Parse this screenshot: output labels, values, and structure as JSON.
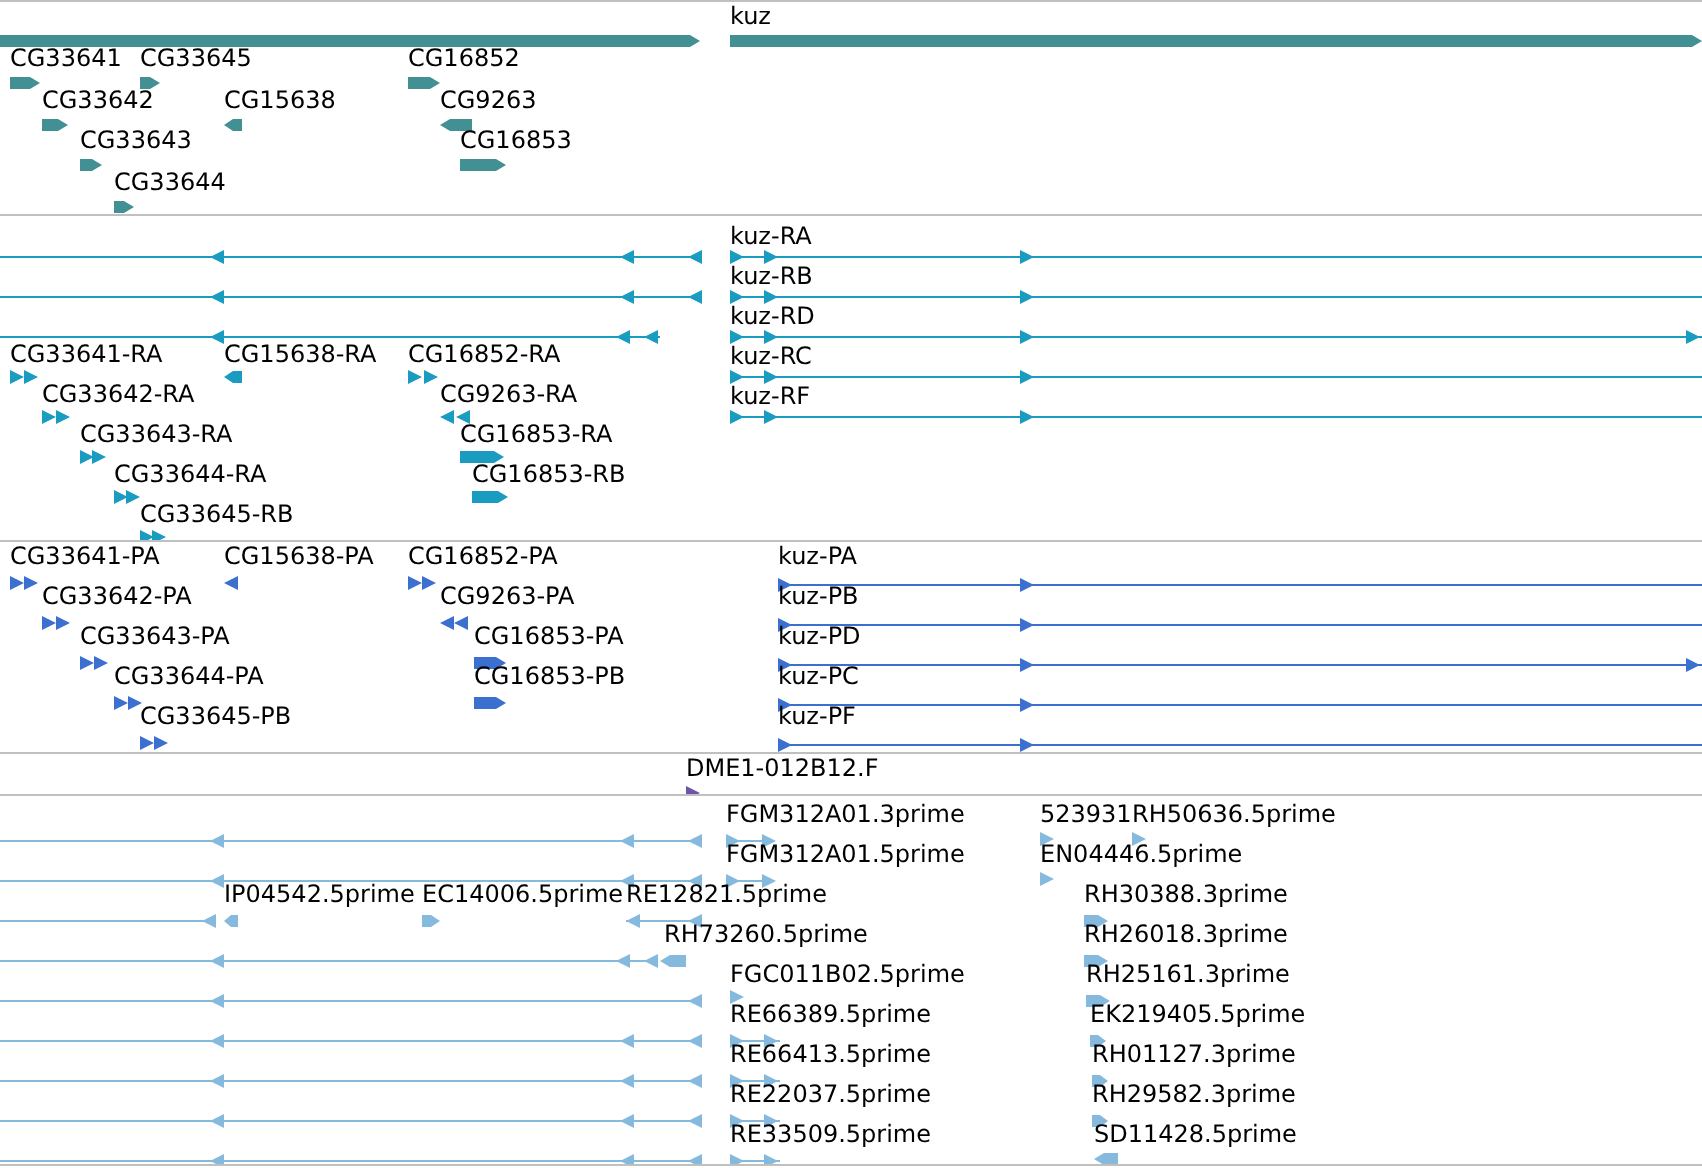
{
  "tracks": [
    {
      "kind": "genes",
      "features": [
        {
          "reverse": false
        },
        {
          "label": "kuz",
          "reverse": false
        },
        {
          "label": "CG33641",
          "reverse": false
        },
        {
          "label": "CG33645",
          "reverse": false
        },
        {
          "label": "CG16852",
          "reverse": false
        },
        {
          "label": "CG33642",
          "reverse": false
        },
        {
          "label": "CG15638",
          "reverse": true
        },
        {
          "label": "CG9263",
          "reverse": true
        },
        {
          "label": "CG33643",
          "reverse": false
        },
        {
          "label": "CG16853",
          "reverse": false
        },
        {
          "label": "CG33644",
          "reverse": false
        }
      ]
    },
    {
      "kind": "transcripts",
      "features": [
        {
          "reverse": true
        },
        {
          "label": "kuz-RA",
          "reverse": false
        },
        {
          "reverse": true
        },
        {
          "label": "kuz-RB",
          "reverse": false
        },
        {
          "reverse": true
        },
        {
          "label": "kuz-RD",
          "reverse": false
        },
        {
          "label": "CG33641-RA",
          "reverse": false
        },
        {
          "label": "CG15638-RA",
          "reverse": true
        },
        {
          "label": "CG16852-RA",
          "reverse": false
        },
        {
          "label": "kuz-RC",
          "reverse": false
        },
        {
          "label": "CG33642-RA",
          "reverse": false
        },
        {
          "label": "CG9263-RA",
          "reverse": true
        },
        {
          "label": "kuz-RF",
          "reverse": false
        },
        {
          "label": "CG33643-RA",
          "reverse": false
        },
        {
          "label": "CG16853-RA",
          "reverse": false
        },
        {
          "label": "CG33644-RA",
          "reverse": false
        },
        {
          "label": "CG16853-RB",
          "reverse": false
        },
        {
          "label": "CG33645-RB",
          "reverse": false
        }
      ]
    },
    {
      "kind": "proteins",
      "features": [
        {
          "label": "CG33641-PA",
          "reverse": false
        },
        {
          "label": "CG15638-PA",
          "reverse": true
        },
        {
          "label": "CG16852-PA",
          "reverse": false
        },
        {
          "label": "kuz-PA",
          "reverse": false
        },
        {
          "label": "CG33642-PA",
          "reverse": false
        },
        {
          "label": "CG9263-PA",
          "reverse": true
        },
        {
          "label": "kuz-PB",
          "reverse": false
        },
        {
          "label": "CG33643-PA",
          "reverse": false
        },
        {
          "label": "CG16853-PA",
          "reverse": false
        },
        {
          "label": "kuz-PD",
          "reverse": false
        },
        {
          "label": "CG33644-PA",
          "reverse": false
        },
        {
          "label": "CG16853-PB",
          "reverse": false
        },
        {
          "label": "kuz-PC",
          "reverse": false
        },
        {
          "label": "CG33645-PB",
          "reverse": false
        },
        {
          "label": "kuz-PF",
          "reverse": false
        }
      ]
    },
    {
      "kind": "clones",
      "features": [
        {
          "label": "DME1-012B12.F",
          "reverse": false
        }
      ]
    },
    {
      "kind": "ests",
      "features": [
        {
          "reverse": true
        },
        {
          "label": "FGM312A01.3prime",
          "reverse": false
        },
        {
          "label": "523931",
          "reverse": false
        },
        {
          "label": "RH50636.5prime",
          "reverse": false
        },
        {
          "reverse": true
        },
        {
          "label": "FGM312A01.5prime",
          "reverse": false
        },
        {
          "label": "EN04446.5prime",
          "reverse": false
        },
        {
          "reverse": true
        },
        {
          "label": "IP04542.5prime",
          "reverse": true
        },
        {
          "label": "EC14006.5prime",
          "reverse": false
        },
        {
          "label": "RE12821.5prime",
          "reverse": true
        },
        {
          "label": "RH30388.3prime",
          "reverse": false
        },
        {
          "reverse": true
        },
        {
          "label": "RH73260.5prime",
          "reverse": true
        },
        {
          "label": "RH26018.3prime",
          "reverse": false
        },
        {
          "reverse": true
        },
        {
          "label": "FGC011B02.5prime",
          "reverse": false
        },
        {
          "label": "RH25161.3prime",
          "reverse": false
        },
        {
          "reverse": true
        },
        {
          "label": "RE66389.5prime",
          "reverse": false
        },
        {
          "label": "EK219405.5prime",
          "reverse": false
        },
        {
          "reverse": true
        },
        {
          "label": "RE66413.5prime",
          "reverse": false
        },
        {
          "label": "RH01127.3prime",
          "reverse": false
        },
        {
          "reverse": true
        },
        {
          "label": "RE22037.5prime",
          "reverse": false
        },
        {
          "label": "RH29582.3prime",
          "reverse": false
        },
        {
          "reverse": true
        },
        {
          "label": "RE33509.5prime",
          "reverse": false
        },
        {
          "label": "SD11428.5prime",
          "reverse": true
        }
      ]
    }
  ]
}
